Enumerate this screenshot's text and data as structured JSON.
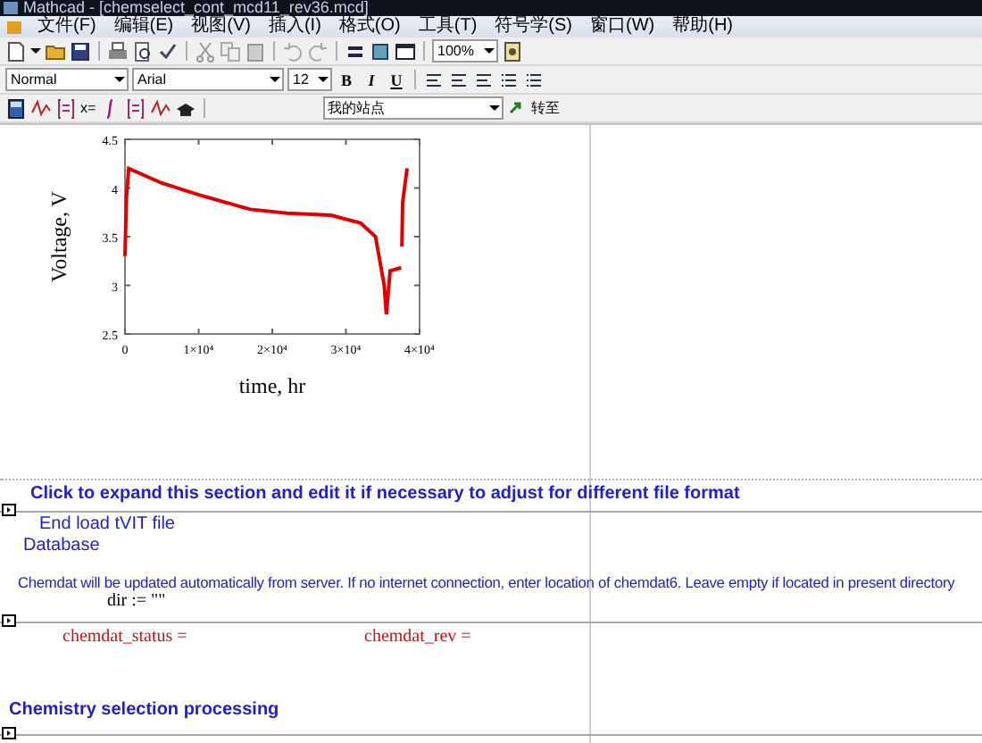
{
  "window": {
    "title": "Mathcad - [chemselect_cont_mcd11_rev36.mcd]"
  },
  "menu": [
    {
      "label": "文件(F)"
    },
    {
      "label": "编辑(E)"
    },
    {
      "label": "视图(V)"
    },
    {
      "label": "插入(I)"
    },
    {
      "label": "格式(O)"
    },
    {
      "label": "工具(T)"
    },
    {
      "label": "符号学(S)"
    },
    {
      "label": "窗口(W)"
    },
    {
      "label": "帮助(H)"
    }
  ],
  "toolbars": {
    "zoom": "100%",
    "style": "Normal",
    "font": "Arial",
    "size": "12",
    "format_buttons": [
      "B",
      "I",
      "U"
    ],
    "math_label": "x=",
    "address": "我的站点",
    "go_label": "转至"
  },
  "worksheet": {
    "chart": {
      "chart_data": {
        "type": "line",
        "xlabel": "time, hr",
        "ylabel": "Voltage, V",
        "x": [
          0,
          200,
          500,
          5000,
          10000,
          17000,
          22000,
          28000,
          32000,
          34000,
          35200,
          35500,
          36000,
          37500,
          37550,
          37600,
          37700,
          38300
        ],
        "series": [
          {
            "color": "#e00000",
            "values": [
              3.3,
              3.9,
              4.2,
              4.05,
              3.93,
              3.78,
              3.74,
              3.72,
              3.64,
              3.5,
              3.0,
              2.7,
              3.15,
              3.18,
              null,
              3.4,
              3.85,
              4.2
            ]
          }
        ],
        "xlim": [
          0,
          40000
        ],
        "ylim": [
          2.5,
          4.5
        ],
        "xticks": [
          0,
          {
            "value": 10000,
            "label": "1×10⁴"
          },
          {
            "value": 20000,
            "label": "2×10⁴"
          },
          {
            "value": 30000,
            "label": "3×10⁴"
          },
          {
            "value": 40000,
            "label": "4×10⁴"
          }
        ],
        "yticks": [
          {
            "value": 2.5,
            "label": "2.5"
          },
          {
            "value": 3,
            "label": "3"
          },
          {
            "value": 3.5,
            "label": "3.5"
          },
          {
            "value": 4,
            "label": "4"
          },
          {
            "value": 4.5,
            "label": "4.5"
          }
        ]
      }
    },
    "expand_note": "Click to expand this section and edit it if necessary to adjust for different file format",
    "end_label": "End load tVIT file",
    "section_title": "Database",
    "note": "Chemdat will be updated automatically from server. If no internet connection, enter location of chemdat6. Leave empty if located in present directory",
    "dir_definition": "dir := \"\"",
    "evaluations": [
      {
        "name": "chemdat_status",
        "operator": "="
      },
      {
        "name": "chemdat_rev",
        "operator": "="
      }
    ],
    "next_section": "Chemistry selection processing"
  }
}
